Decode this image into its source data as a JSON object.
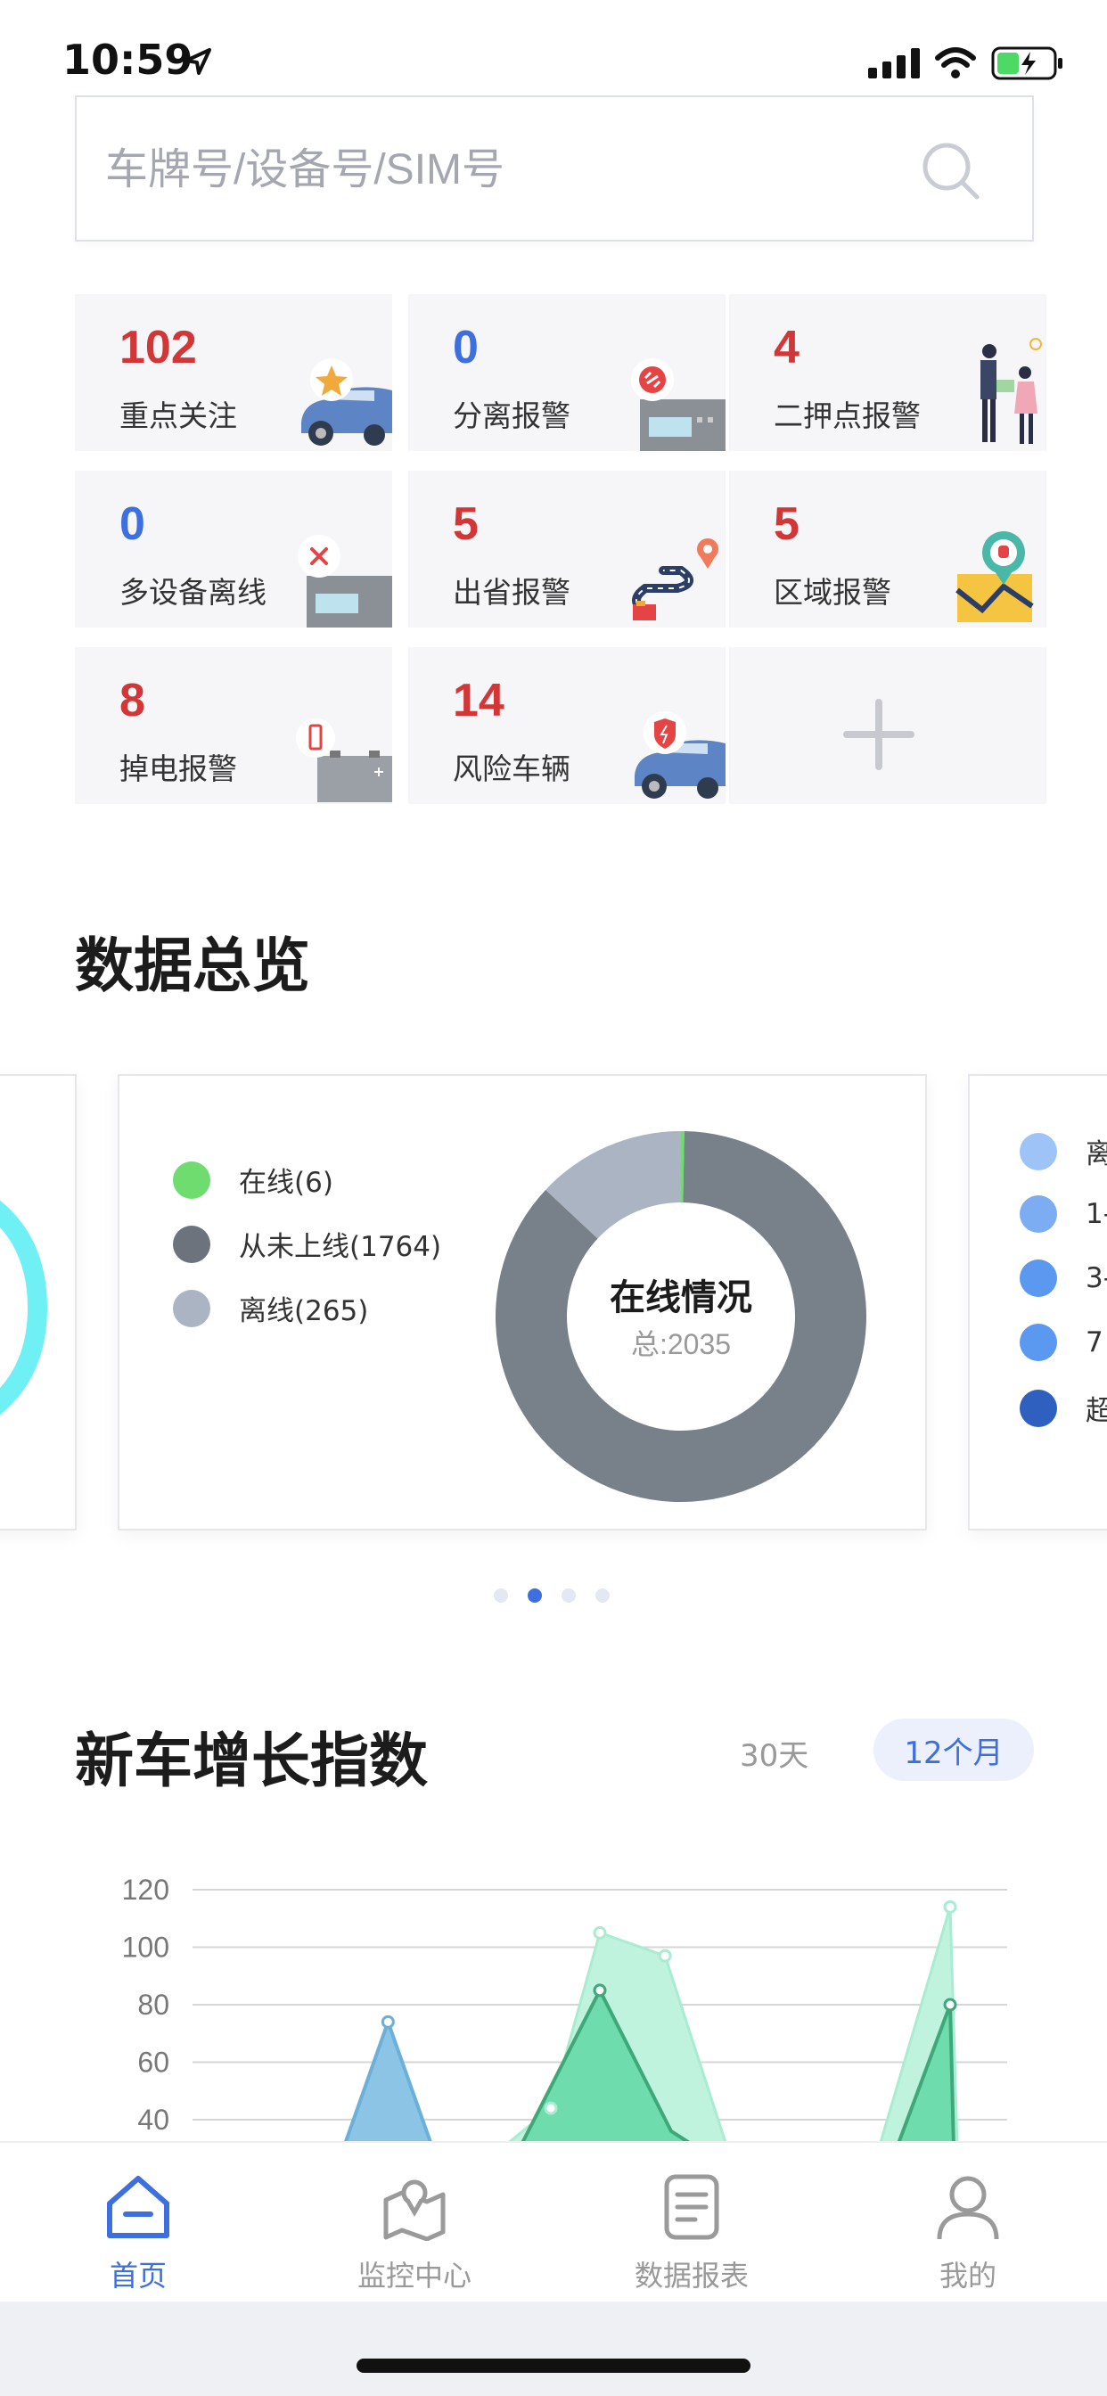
{
  "status_bar": {
    "time": "10:59"
  },
  "search": {
    "placeholder": "车牌号/设备号/SIM号"
  },
  "alerts": [
    {
      "count": "102",
      "label": "重点关注",
      "color": "#d23636",
      "icon": "car-star-icon"
    },
    {
      "count": "0",
      "label": "分离报警",
      "color": "#3e6fde",
      "icon": "device-separation-icon"
    },
    {
      "count": "4",
      "label": "二押点报警",
      "color": "#d23636",
      "icon": "people-handover-icon"
    },
    {
      "count": "0",
      "label": "多设备离线",
      "color": "#3e6fde",
      "icon": "device-offline-icon"
    },
    {
      "count": "5",
      "label": "出省报警",
      "color": "#d23636",
      "icon": "route-pin-icon"
    },
    {
      "count": "5",
      "label": "区域报警",
      "color": "#d23636",
      "icon": "map-alarm-icon"
    },
    {
      "count": "8",
      "label": "掉电报警",
      "color": "#d23636",
      "icon": "battery-icon"
    },
    {
      "count": "14",
      "label": "风险车辆",
      "color": "#d23636",
      "icon": "car-shield-icon"
    }
  ],
  "add_card": {
    "icon": "plus-icon"
  },
  "overview": {
    "title": "数据总览",
    "online_card": {
      "chart_data": {
        "type": "pie",
        "title": "在线情况",
        "subtitle": "总:2035",
        "series": [
          {
            "name": "在线(6)",
            "value": 6,
            "color": "#6fdc6f"
          },
          {
            "name": "从未上线(1764)",
            "value": 1764,
            "color": "#78808a"
          },
          {
            "name": "离线(265)",
            "value": 265,
            "color": "#aab4c2"
          }
        ]
      }
    },
    "right_legend_partial": [
      {
        "label": "离",
        "color": "#9ec3f7"
      },
      {
        "label": "1-",
        "color": "#7cacf2"
      },
      {
        "label": "3-",
        "color": "#5b98f0"
      },
      {
        "label": "7",
        "color": "#5b98f0"
      },
      {
        "label": "超",
        "color": "#2f5fbf"
      }
    ],
    "pager": {
      "count": 4,
      "active": 1
    }
  },
  "growth": {
    "title": "新车增长指数",
    "tabs": {
      "days30": "30天",
      "months12": "12个月",
      "active": "12个月"
    },
    "chart_data": {
      "type": "area",
      "yticks": [
        "120",
        "100",
        "80",
        "60",
        "40"
      ],
      "ylim": [
        40,
        120
      ],
      "note": "partially visible; only peaks above 40 shown",
      "series": [
        {
          "color": "#6ab0d8",
          "peaks": [
            {
              "x": 0.24,
              "y": 74
            }
          ]
        },
        {
          "color": "#a8ecd2",
          "peaks": [
            {
              "x": 0.5,
              "y": 105
            },
            {
              "x": 0.58,
              "y": 97
            },
            {
              "x": 0.93,
              "y": 114
            }
          ]
        },
        {
          "color": "#55d49a",
          "peaks": [
            {
              "x": 0.5,
              "y": 85
            },
            {
              "x": 0.93,
              "y": 80
            }
          ]
        }
      ]
    }
  },
  "nav": {
    "items": [
      {
        "label": "首页",
        "icon": "home-icon",
        "active": true
      },
      {
        "label": "监控中心",
        "icon": "map-pin-icon",
        "active": false
      },
      {
        "label": "数据报表",
        "icon": "report-icon",
        "active": false
      },
      {
        "label": "我的",
        "icon": "user-icon",
        "active": false
      }
    ],
    "active_color": "#3e6fde",
    "inactive_color": "#999999"
  }
}
